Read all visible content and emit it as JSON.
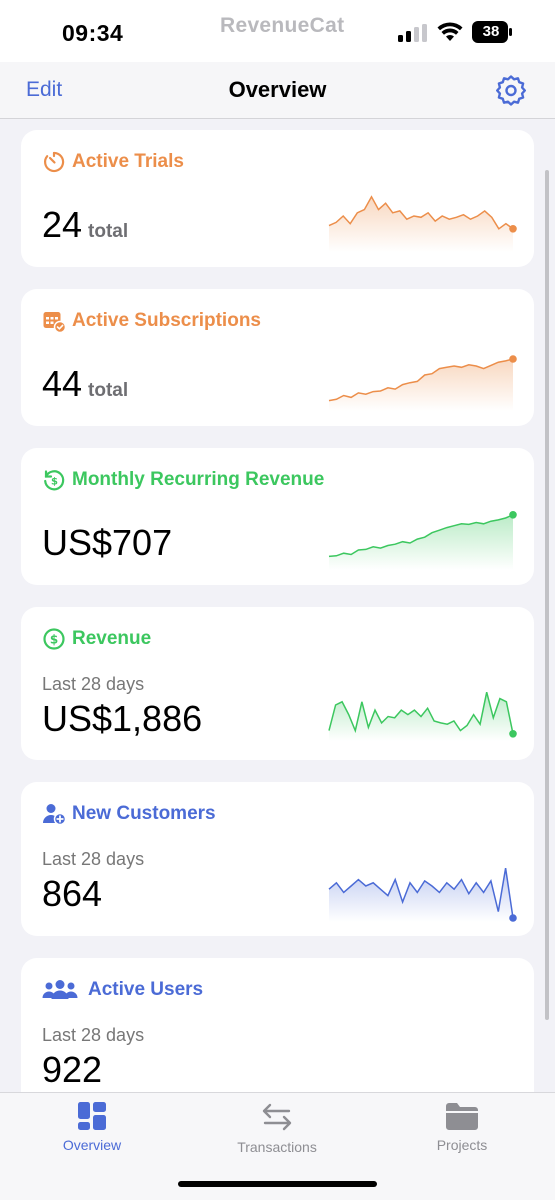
{
  "status_bar": {
    "time": "09:34",
    "brand": "RevenueCat",
    "battery": "38"
  },
  "nav": {
    "edit": "Edit",
    "title": "Overview",
    "settings_icon": "gear-icon"
  },
  "colors": {
    "orange": "#ec8e4a",
    "green": "#3cc75f",
    "blue": "#4b6bd6"
  },
  "cards": [
    {
      "title": "Active Trials",
      "icon": "timer-icon",
      "value": "24",
      "unit": "total",
      "color": "#ec8e4a",
      "spark": [
        0.35,
        0.4,
        0.5,
        0.38,
        0.55,
        0.6,
        0.8,
        0.6,
        0.7,
        0.55,
        0.58,
        0.45,
        0.5,
        0.48,
        0.55,
        0.42,
        0.5,
        0.45,
        0.48,
        0.52,
        0.45,
        0.5,
        0.58,
        0.48,
        0.3,
        0.38,
        0.3
      ]
    },
    {
      "title": "Active Subscriptions",
      "icon": "calendar-check-icon",
      "value": "44",
      "unit": "total",
      "color": "#ec8e4a",
      "spark": [
        0.1,
        0.12,
        0.18,
        0.15,
        0.22,
        0.2,
        0.24,
        0.25,
        0.3,
        0.28,
        0.35,
        0.38,
        0.4,
        0.5,
        0.52,
        0.6,
        0.62,
        0.64,
        0.62,
        0.66,
        0.64,
        0.6,
        0.65,
        0.7,
        0.72,
        0.75
      ]
    },
    {
      "title": "Monthly Recurring Revenue",
      "icon": "dollar-cycle-icon",
      "value": "US$707",
      "unit": "",
      "color": "#3cc75f",
      "spark": [
        0.15,
        0.16,
        0.2,
        0.18,
        0.25,
        0.26,
        0.3,
        0.28,
        0.32,
        0.34,
        0.38,
        0.36,
        0.42,
        0.45,
        0.52,
        0.56,
        0.6,
        0.63,
        0.66,
        0.65,
        0.68,
        0.66,
        0.7,
        0.72,
        0.75,
        0.8
      ]
    },
    {
      "title": "Revenue",
      "subtitle": "Last 28 days",
      "icon": "dollar-circle-icon",
      "value": "US$1,886",
      "unit": "",
      "color": "#3cc75f",
      "spark": [
        0.1,
        0.5,
        0.55,
        0.35,
        0.1,
        0.55,
        0.15,
        0.42,
        0.22,
        0.32,
        0.3,
        0.42,
        0.35,
        0.42,
        0.32,
        0.45,
        0.25,
        0.22,
        0.2,
        0.25,
        0.1,
        0.18,
        0.35,
        0.2,
        0.7,
        0.3,
        0.6,
        0.55,
        0.05
      ]
    },
    {
      "title": "New Customers",
      "subtitle": "Last 28 days",
      "icon": "user-add-icon",
      "value": "864",
      "unit": "",
      "color": "#4b6bd6",
      "spark": [
        0.45,
        0.55,
        0.4,
        0.5,
        0.6,
        0.5,
        0.55,
        0.45,
        0.35,
        0.6,
        0.25,
        0.55,
        0.4,
        0.58,
        0.5,
        0.4,
        0.55,
        0.45,
        0.6,
        0.38,
        0.55,
        0.4,
        0.58,
        0.1,
        0.78,
        0.0
      ]
    },
    {
      "title": "Active Users",
      "subtitle": "Last 28 days",
      "icon": "users-icon",
      "value": "922",
      "unit": "",
      "color": "#4b6bd6",
      "spark": []
    }
  ],
  "tabs": [
    {
      "label": "Overview",
      "icon": "dashboard-icon",
      "active": true
    },
    {
      "label": "Transactions",
      "icon": "arrows-swap-icon",
      "active": false
    },
    {
      "label": "Projects",
      "icon": "folder-icon",
      "active": false
    }
  ]
}
